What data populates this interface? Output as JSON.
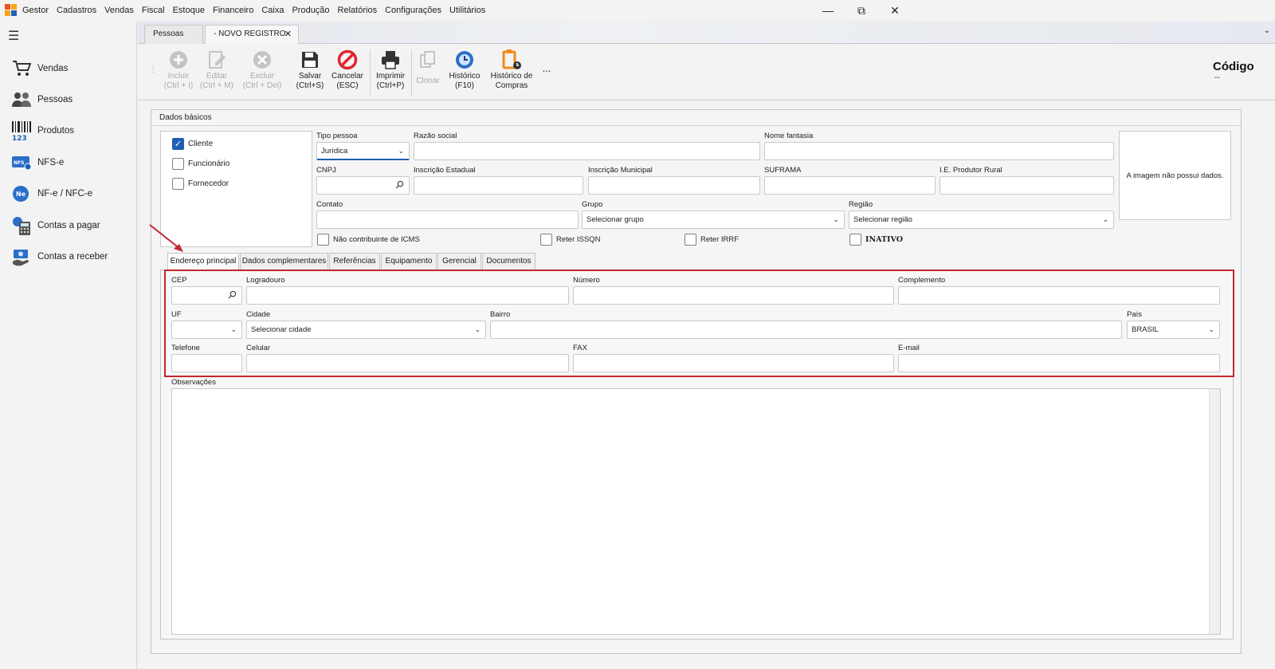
{
  "app": {
    "name": "Gestor"
  },
  "menu": [
    "Cadastros",
    "Vendas",
    "Fiscal",
    "Estoque",
    "Financeiro",
    "Caixa",
    "Produção",
    "Relatórios",
    "Configurações",
    "Utilitários"
  ],
  "window_controls": {
    "minimize": "—",
    "restore": "⧉",
    "close": "✕"
  },
  "sidebar": {
    "items": [
      {
        "label": "Vendas",
        "icon": "cart-icon"
      },
      {
        "label": "Pessoas",
        "icon": "people-icon"
      },
      {
        "label": "Produtos",
        "icon": "barcode-icon"
      },
      {
        "label": "NFS-e",
        "icon": "nfse-icon"
      },
      {
        "label": "NF-e / NFC-e",
        "icon": "nfe-icon"
      },
      {
        "label": "Contas a pagar",
        "icon": "calculator-icon"
      },
      {
        "label": "Contas a receber",
        "icon": "money-icon"
      }
    ]
  },
  "doc_tabs": [
    {
      "label": "Pessoas"
    },
    {
      "label": "- NOVO REGISTRO"
    }
  ],
  "toolbar": {
    "incluir": "Incluir\n(Ctrl + I)",
    "editar": "Editar\n(Ctrl + M)",
    "excluir": "Excluir\n(Ctrl + Del)",
    "salvar": "Salvar\n(Ctrl+S)",
    "cancelar": "Cancelar\n(ESC)",
    "imprimir": "Imprimir\n(Ctrl+P)",
    "clonar": "Clonar",
    "historico": "Histórico\n(F10)",
    "historico_compras": "Histórico de\nCompras",
    "more": "..."
  },
  "header": {
    "codigo_label": "Código",
    "codigo_value": "--"
  },
  "dados_basicos": {
    "title": "Dados básicos",
    "roles": [
      {
        "label": "Cliente",
        "checked": true
      },
      {
        "label": "Funcionário",
        "checked": false
      },
      {
        "label": "Fornecedor",
        "checked": false
      }
    ],
    "tipo_pessoa": {
      "label": "Tipo pessoa",
      "value": "Jurídica"
    },
    "razao_social": {
      "label": "Razão social",
      "value": ""
    },
    "nome_fantasia": {
      "label": "Nome fantasia",
      "value": ""
    },
    "cnpj": {
      "label": "CNPJ",
      "value": ""
    },
    "inscricao_estadual": {
      "label": "Inscrição Estadual",
      "value": ""
    },
    "inscricao_municipal": {
      "label": "Inscrição Municipal",
      "value": ""
    },
    "suframa": {
      "label": "SUFRAMA",
      "value": ""
    },
    "ie_produtor_rural": {
      "label": "I.E. Produtor Rural",
      "value": ""
    },
    "contato": {
      "label": "Contato",
      "value": ""
    },
    "grupo": {
      "label": "Grupo",
      "value": "Selecionar grupo"
    },
    "regiao": {
      "label": "Região",
      "value": "Selecionar região"
    },
    "image_placeholder": "A imagem não possui dados.",
    "checks": {
      "nao_contribuinte": {
        "label": "Não contribuinte de ICMS",
        "checked": false
      },
      "reter_issqn": {
        "label": "Reter ISSQN",
        "checked": false
      },
      "reter_irrf": {
        "label": "Reter IRRF",
        "checked": false
      },
      "inativo": {
        "label": "INATIVO",
        "checked": false
      }
    }
  },
  "inner_tabs": [
    "Endereço principal",
    "Dados complementares",
    "Referências",
    "Equipamento",
    "Gerencial",
    "Documentos"
  ],
  "endereco": {
    "cep": {
      "label": "CEP",
      "value": ""
    },
    "logradouro": {
      "label": "Logradouro",
      "value": ""
    },
    "numero": {
      "label": "Número",
      "value": ""
    },
    "complemento": {
      "label": "Complemento",
      "value": ""
    },
    "uf": {
      "label": "UF",
      "value": ""
    },
    "cidade": {
      "label": "Cidade",
      "value": "Selecionar cidade"
    },
    "bairro": {
      "label": "Bairro",
      "value": ""
    },
    "pais": {
      "label": "País",
      "value": "BRASIL"
    },
    "telefone": {
      "label": "Telefone",
      "value": ""
    },
    "celular": {
      "label": "Celular",
      "value": ""
    },
    "fax": {
      "label": "FAX",
      "value": ""
    },
    "email": {
      "label": "E-mail",
      "value": ""
    }
  },
  "observacoes": {
    "label": "Observações",
    "value": ""
  },
  "colors": {
    "accent": "#1f5fb5",
    "highlight": "#c0282d",
    "cancel": "#e0252b",
    "orange": "#f08a1c"
  }
}
